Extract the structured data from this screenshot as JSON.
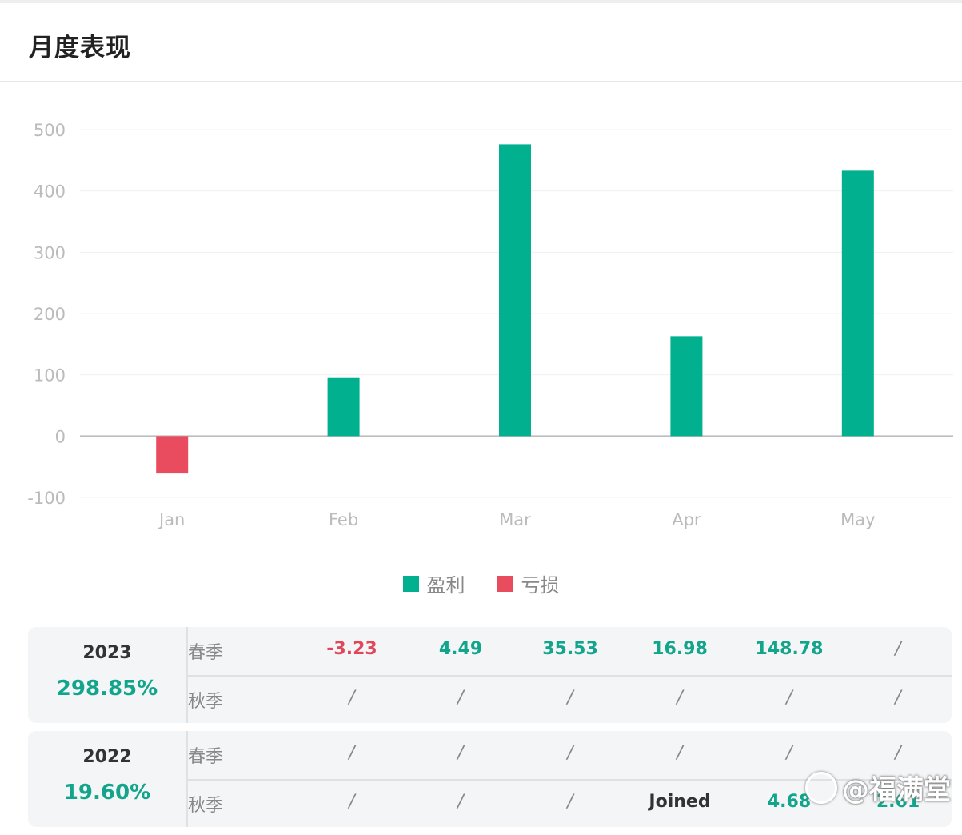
{
  "header": {
    "title": "月度表现"
  },
  "chart_data": {
    "type": "bar",
    "categories": [
      "Jan",
      "Feb",
      "Mar",
      "Apr",
      "May"
    ],
    "values": [
      -61,
      96,
      476,
      163,
      433
    ],
    "ylim": [
      -100,
      500
    ],
    "yticks": [
      -100,
      0,
      100,
      200,
      300,
      400,
      500
    ],
    "grid": true,
    "colors": {
      "positive": "#00b08f",
      "negative": "#e94b5f"
    },
    "legend": {
      "position": "bottom-center",
      "entries": [
        {
          "label": "盈利",
          "color": "#00b08f"
        },
        {
          "label": "亏损",
          "color": "#e94b5f"
        }
      ]
    }
  },
  "performance": [
    {
      "year": "2023",
      "total": "298.85%",
      "rows": [
        {
          "season": "春季",
          "values": [
            "-3.23",
            "4.49",
            "35.53",
            "16.98",
            "148.78",
            "/"
          ]
        },
        {
          "season": "秋季",
          "values": [
            "/",
            "/",
            "/",
            "/",
            "/",
            "/"
          ]
        }
      ]
    },
    {
      "year": "2022",
      "total": "19.60%",
      "rows": [
        {
          "season": "春季",
          "values": [
            "/",
            "/",
            "/",
            "/",
            "/",
            "/"
          ]
        },
        {
          "season": "秋季",
          "values": [
            "/",
            "/",
            "/",
            "Joined",
            "4.68",
            "2.61"
          ]
        }
      ]
    }
  ],
  "watermark": {
    "text": "@福满堂",
    "icon": "snowball-logo-icon"
  }
}
